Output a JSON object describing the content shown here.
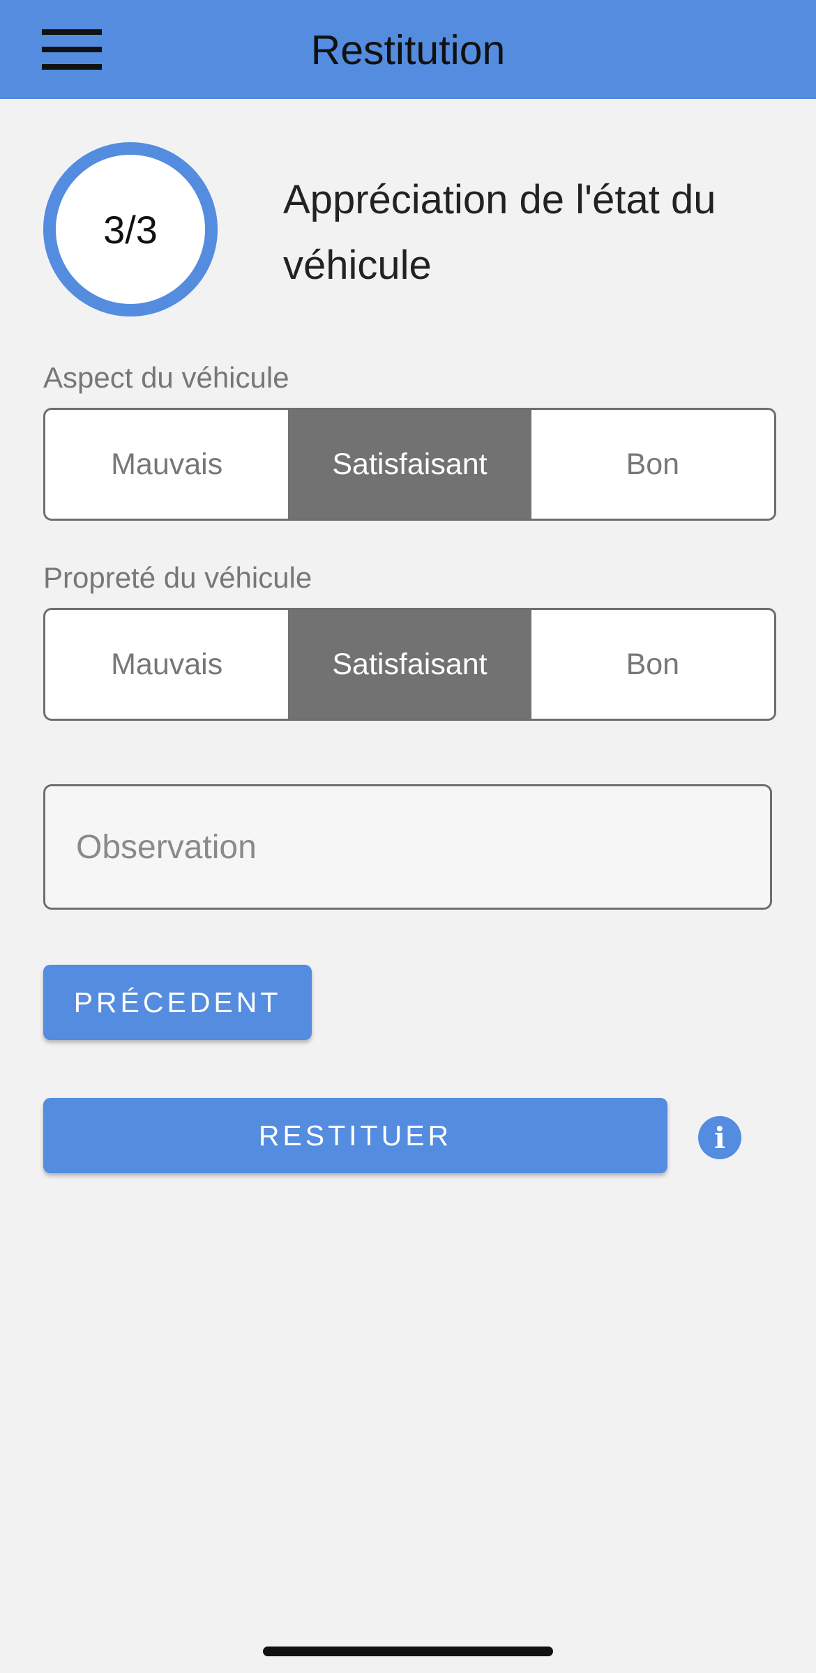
{
  "header": {
    "title": "Restitution",
    "menu_icon": "hamburger-menu-icon"
  },
  "step": {
    "indicator": "3/3",
    "heading": "Appréciation de l'état du véhicule"
  },
  "aspect": {
    "label": "Aspect du véhicule",
    "options": [
      "Mauvais",
      "Satisfaisant",
      "Bon"
    ],
    "selected": "Satisfaisant"
  },
  "proprete": {
    "label": "Propreté du véhicule",
    "options": [
      "Mauvais",
      "Satisfaisant",
      "Bon"
    ],
    "selected": "Satisfaisant"
  },
  "observation": {
    "placeholder": "Observation",
    "value": ""
  },
  "buttons": {
    "previous": "PRÉCEDENT",
    "submit": "RESTITUER"
  },
  "info": {
    "icon": "info-icon",
    "glyph": "i"
  },
  "colors": {
    "accent": "#548cdf",
    "selected_segment": "#727272",
    "background": "#f2f2f3"
  }
}
